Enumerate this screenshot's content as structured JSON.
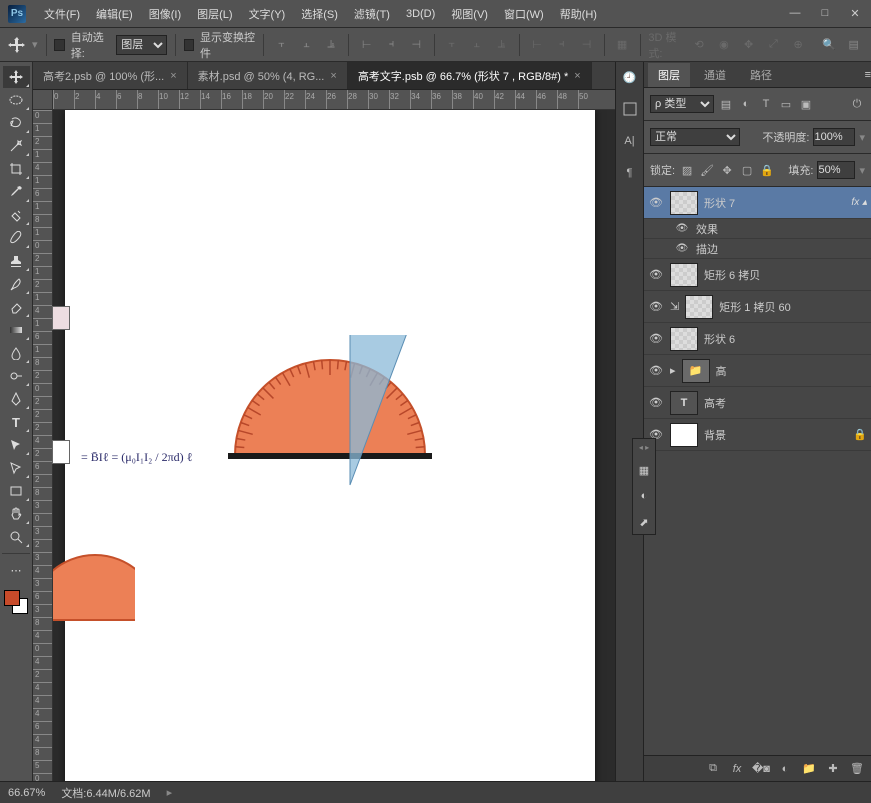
{
  "app": {
    "logo": "Ps"
  },
  "menu": [
    "文件(F)",
    "编辑(E)",
    "图像(I)",
    "图层(L)",
    "文字(Y)",
    "选择(S)",
    "滤镜(T)",
    "3D(D)",
    "视图(V)",
    "窗口(W)",
    "帮助(H)"
  ],
  "window": {
    "min": "—",
    "max": "□",
    "close": "✕"
  },
  "options": {
    "auto_select_label": "自动选择:",
    "auto_select_dropdown": "图层",
    "show_transform": "显示变换控件",
    "mode3d": "3D 模式:"
  },
  "tabs": [
    {
      "label": "高考2.psb @ 100% (形...",
      "active": false
    },
    {
      "label": "素材.psd @ 50% (4, RG...",
      "active": false
    },
    {
      "label": "高考文字.psb @ 66.7% (形状 7 , RGB/8#) *",
      "active": true
    }
  ],
  "panels": {
    "tabs": [
      "图层",
      "通道",
      "路径"
    ],
    "filter_kind": "ρ 类型",
    "blend": "正常",
    "opacity_label": "不透明度:",
    "opacity": "100%",
    "lock_label": "锁定:",
    "fill_label": "填充:",
    "fill": "50%"
  },
  "layers": [
    {
      "name": "形状 7",
      "selected": true,
      "fx": true,
      "kind": "shape"
    },
    {
      "name": "效果",
      "sub": true
    },
    {
      "name": "描边",
      "sub": true,
      "eye": true
    },
    {
      "name": "矩形 6 拷贝",
      "kind": "shape"
    },
    {
      "name": "矩形 1 拷贝 60",
      "kind": "shape",
      "linked": true
    },
    {
      "name": "形状 6",
      "kind": "shape"
    },
    {
      "name": "高",
      "kind": "folder"
    },
    {
      "name": "高考",
      "kind": "text"
    },
    {
      "name": "背景",
      "kind": "bg",
      "locked": true
    }
  ],
  "status": {
    "zoom": "66.67%",
    "doc": "文档:6.44M/6.62M"
  },
  "ruler_h": [
    "0",
    "2",
    "4",
    "6",
    "8",
    "10",
    "12",
    "14",
    "16",
    "18",
    "20",
    "22",
    "24",
    "26",
    "28",
    "30",
    "32",
    "34",
    "36",
    "38",
    "40",
    "42",
    "44",
    "46",
    "48",
    "50"
  ],
  "ruler_v": [
    "0",
    "1",
    "2",
    "1",
    "4",
    "1",
    "6",
    "1",
    "8",
    "1",
    "0",
    "2",
    "1",
    "2",
    "1",
    "4",
    "1",
    "6",
    "1",
    "8",
    "2",
    "0",
    "2",
    "2",
    "2",
    "4",
    "2",
    "6",
    "2",
    "8",
    "3",
    "0",
    "3",
    "2",
    "3",
    "4",
    "3",
    "6",
    "3",
    "8",
    "4",
    "0",
    "4",
    "2",
    "4",
    "4",
    "4",
    "6",
    "4",
    "8",
    "5",
    "0"
  ],
  "equation": "= B̄Iℓ = (μ₀I₁I₂ / 2πd) ℓ"
}
